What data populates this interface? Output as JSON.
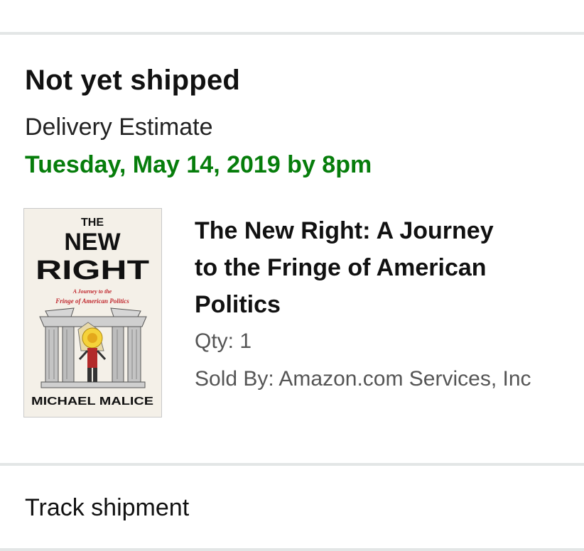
{
  "shipment": {
    "status": "Not yet shipped",
    "estimate_label": "Delivery Estimate",
    "estimate_date": "Tuesday, May 14, 2019 by 8pm",
    "estimate_color": "#067d0b"
  },
  "item": {
    "title": "The New Right: A Journey to the Fringe of American Politics",
    "qty": "Qty: 1",
    "seller": "Sold By: Amazon.com Services, Inc",
    "cover": {
      "the": "THE",
      "new": "NEW",
      "right": "RIGHT",
      "subtitle_line1": "A Journey to the",
      "subtitle_line2": "Fringe of American Politics",
      "author": "MICHAEL MALICE"
    }
  },
  "actions": {
    "track_label": "Track shipment"
  }
}
